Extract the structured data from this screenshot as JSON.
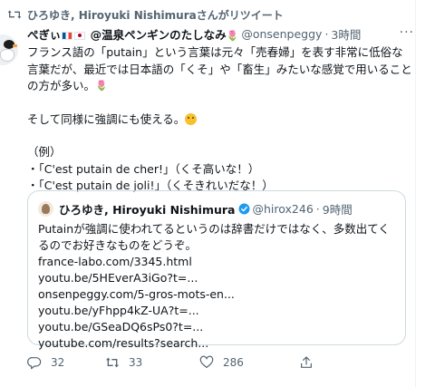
{
  "retweet_bar": {
    "text": "ひろゆき, Hiroyuki Nishimuraさんがリツイート"
  },
  "tweet": {
    "name_prefix": "ぺぎぃ",
    "name_main": "@温泉ペンギンのたしなみ",
    "handle": "@onsenpeggy",
    "separator": "·",
    "time": "3時間",
    "body_lines": [
      "フランス語の「putain」という言葉は元々「売春婦」を表す非常に低俗な言葉だが、最近では日本語の「くそ」や「畜生」みたいな感覚で用いることの方が多い。",
      "そして同様に強調にも使える。",
      "（例）",
      "・「C'est putain de cher!」（くそ高いな！）",
      "・「C'est putain de joli!」（くそきれいだな！）"
    ],
    "icons": {
      "more": "more-dots-icon",
      "tulip": "🌷"
    }
  },
  "quote": {
    "name": "ひろゆき, Hiroyuki Nishimura",
    "handle": "@hirox246",
    "separator": "·",
    "time": "9時間",
    "text": "Putainが強調に使われてるというのは辞書だけではなく、多数出てくるのでお好きなものをどうぞ。",
    "links": [
      "france-labo.com/3345.html",
      "youtu.be/5HEverA3iGo?t=...",
      "onsenpeggy.com/5-gros-mots-en...",
      "youtu.be/yFhpp4kZ-UA?t=...",
      "youtu.be/GSeaDQ6sPs0?t=...",
      "youtube.com/results?search..."
    ]
  },
  "actions": {
    "reply_count": "32",
    "retweet_count": "33",
    "like_count": "286"
  },
  "colors": {
    "text": "#0f1419",
    "muted": "#536471",
    "border": "#cfd9de",
    "verified": "#1d9bf0"
  }
}
